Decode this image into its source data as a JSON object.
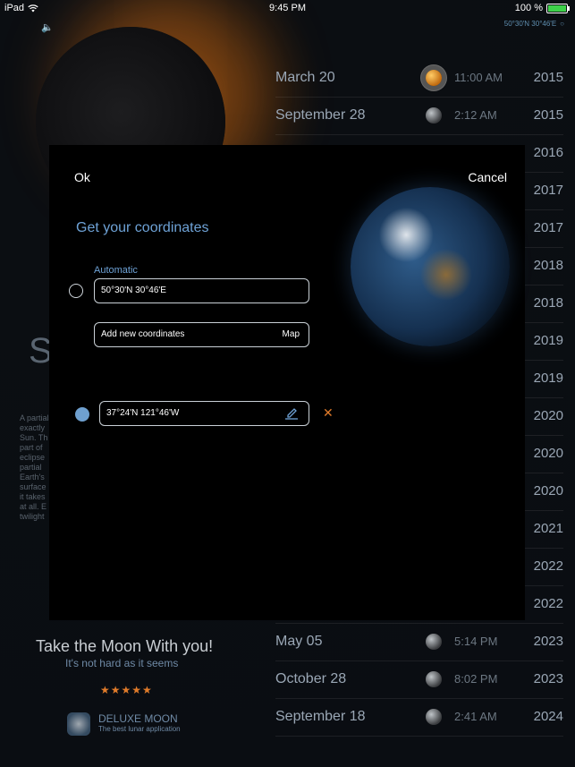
{
  "status_bar": {
    "device": "iPad",
    "time": "9:45 PM",
    "battery": "100 %"
  },
  "background": {
    "location_readout": "50°30'N 30°46'E",
    "heading_fragment": "S",
    "paragraph_fragment": "A partial exactly Sun. Th part of eclipse partial Earth's surface it takes at all. E twilight",
    "events": [
      {
        "date": "March 20",
        "time": "11:00 AM",
        "year": "2015",
        "body": "sun"
      },
      {
        "date": "September 28",
        "time": "2:12 AM",
        "year": "2015",
        "body": "moon"
      },
      {
        "date": "",
        "time": "",
        "year": "2016",
        "body": ""
      },
      {
        "date": "",
        "time": "",
        "year": "2017",
        "body": ""
      },
      {
        "date": "",
        "time": "",
        "year": "2017",
        "body": ""
      },
      {
        "date": "",
        "time": "",
        "year": "2018",
        "body": ""
      },
      {
        "date": "",
        "time": "",
        "year": "2018",
        "body": ""
      },
      {
        "date": "",
        "time": "",
        "year": "2019",
        "body": ""
      },
      {
        "date": "",
        "time": "",
        "year": "2019",
        "body": ""
      },
      {
        "date": "",
        "time": "",
        "year": "2020",
        "body": ""
      },
      {
        "date": "",
        "time": "",
        "year": "2020",
        "body": ""
      },
      {
        "date": "",
        "time": "",
        "year": "2020",
        "body": ""
      },
      {
        "date": "",
        "time": "",
        "year": "2021",
        "body": ""
      },
      {
        "date": "",
        "time": "",
        "year": "2022",
        "body": ""
      },
      {
        "date": "",
        "time": "",
        "year": "2022",
        "body": ""
      },
      {
        "date": "May 05",
        "time": "5:14 PM",
        "year": "2023",
        "body": "moon"
      },
      {
        "date": "October 28",
        "time": "8:02 PM",
        "year": "2023",
        "body": "moon"
      },
      {
        "date": "September 18",
        "time": "2:41 AM",
        "year": "2024",
        "body": "moon"
      }
    ],
    "promo": {
      "title": "Take the Moon With you!",
      "subtitle": "It's not hard as it seems",
      "stars": "★★★★★",
      "app_name": "DELUXE MOON",
      "app_tagline": "The best lunar application"
    }
  },
  "modal": {
    "ok_label": "Ok",
    "cancel_label": "Cancel",
    "heading": "Get your coordinates",
    "automatic_label": "Automatic",
    "automatic_value": "50°30'N 30°46'E",
    "add_label": "Add new coordinates",
    "map_label": "Map",
    "saved_value": "37°24'N 121°46'W",
    "close_glyph": "✕"
  },
  "colors": {
    "accent_blue": "#6ea2d6",
    "accent_orange": "#e07b2a",
    "battery_green": "#3ed14a"
  }
}
